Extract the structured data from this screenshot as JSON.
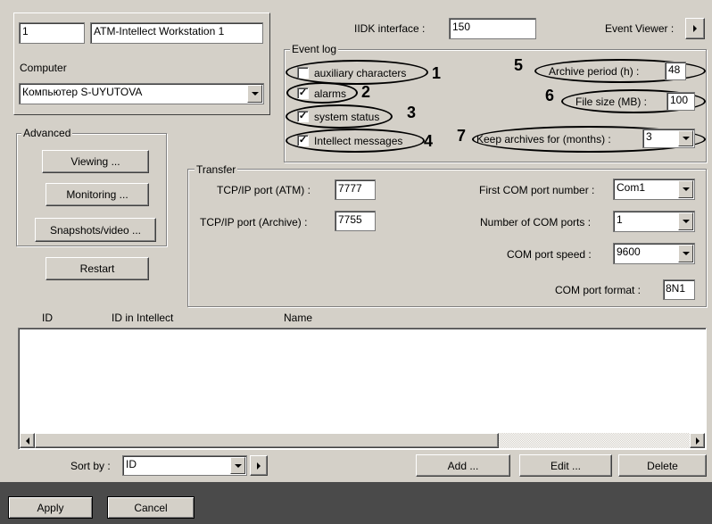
{
  "top": {
    "id_value": "1",
    "name_value": "ATM-Intellect Workstation 1",
    "computer_label": "Computer",
    "computer_value": "Компьютер S-UYUTOVA",
    "iidk_label": "IIDK interface :",
    "iidk_value": "150",
    "event_viewer_label": "Event Viewer :",
    "event_viewer_btn": ">"
  },
  "advanced": {
    "title": "Advanced",
    "viewing": "Viewing ...",
    "monitoring": "Monitoring ...",
    "snapshots": "Snapshots/video ...",
    "restart": "Restart"
  },
  "event_log": {
    "title": "Event log",
    "items": [
      {
        "label": "auxiliary characters",
        "checked": false,
        "mark": "1"
      },
      {
        "label": "alarms",
        "checked": true,
        "mark": "2"
      },
      {
        "label": "system status",
        "checked": true,
        "mark": "3"
      },
      {
        "label": "Intellect messages",
        "checked": true,
        "mark": "4"
      }
    ],
    "archive_period_label": "Archive period (h) :",
    "archive_period_value": "48",
    "archive_period_mark": "5",
    "file_size_label": "File size (MB) :",
    "file_size_value": "100",
    "file_size_mark": "6",
    "keep_label": "Keep archives for (months) :",
    "keep_value": "3",
    "keep_mark": "7"
  },
  "transfer": {
    "title": "Transfer",
    "tcp_atm_label": "TCP/IP port (ATM) :",
    "tcp_atm_value": "7777",
    "tcp_archive_label": "TCP/IP port (Archive) :",
    "tcp_archive_value": "7755",
    "first_com_label": "First COM port number :",
    "first_com_value": "Com1",
    "num_com_label": "Number of COM ports :",
    "num_com_value": "1",
    "com_speed_label": "COM port speed :",
    "com_speed_value": "9600",
    "com_format_label": "COM port format :",
    "com_format_value": "8N1"
  },
  "table": {
    "columns": [
      "ID",
      "ID in Intellect",
      "Name"
    ]
  },
  "sort": {
    "label": "Sort by :",
    "value": "ID",
    "arrow_btn": ">"
  },
  "actions": {
    "add": "Add ...",
    "edit": "Edit ...",
    "delete": "Delete",
    "apply": "Apply",
    "cancel": "Cancel"
  }
}
